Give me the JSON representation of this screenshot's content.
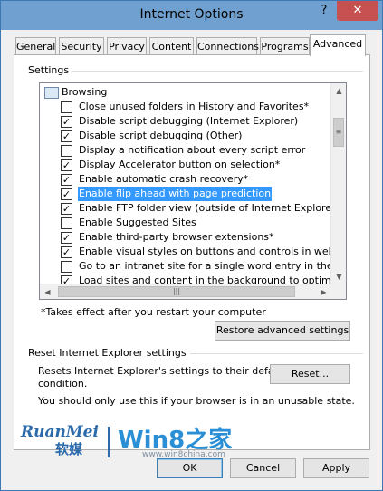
{
  "window": {
    "title": "Internet Options",
    "help_glyph": "?",
    "close_glyph": "✕"
  },
  "tabs": [
    {
      "label": "General",
      "active": false
    },
    {
      "label": "Security",
      "active": false
    },
    {
      "label": "Privacy",
      "active": false
    },
    {
      "label": "Content",
      "active": false
    },
    {
      "label": "Connections",
      "active": false
    },
    {
      "label": "Programs",
      "active": false
    },
    {
      "label": "Advanced",
      "active": true
    }
  ],
  "settings": {
    "group_label": "Settings",
    "category": "Browsing",
    "items": [
      {
        "label": "Close unused folders in History and Favorites*",
        "checked": false,
        "selected": false
      },
      {
        "label": "Disable script debugging (Internet Explorer)",
        "checked": true,
        "selected": false
      },
      {
        "label": "Disable script debugging (Other)",
        "checked": true,
        "selected": false
      },
      {
        "label": "Display a notification about every script error",
        "checked": false,
        "selected": false
      },
      {
        "label": "Display Accelerator button on selection*",
        "checked": true,
        "selected": false
      },
      {
        "label": "Enable automatic crash recovery*",
        "checked": true,
        "selected": false
      },
      {
        "label": "Enable flip ahead with page prediction",
        "checked": true,
        "selected": true
      },
      {
        "label": "Enable FTP folder view (outside of Internet Explorer)",
        "checked": true,
        "selected": false
      },
      {
        "label": "Enable Suggested Sites",
        "checked": false,
        "selected": false
      },
      {
        "label": "Enable third-party browser extensions*",
        "checked": true,
        "selected": false
      },
      {
        "label": "Enable visual styles on buttons and controls in webpages",
        "checked": true,
        "selected": false
      },
      {
        "label": "Go to an intranet site for a single word entry in the Address",
        "checked": false,
        "selected": false
      },
      {
        "label": "Load sites and content in the background to optimize perfo",
        "checked": true,
        "selected": false
      }
    ],
    "check_glyph": "✓",
    "note": "*Takes effect after you restart your computer",
    "restore_button": "Restore advanced settings"
  },
  "reset": {
    "group_label": "Reset Internet Explorer settings",
    "description_line1": "Resets Internet Explorer's settings to their default",
    "description_line2": "condition.",
    "button": "Reset...",
    "warning": "You should only use this if your browser is in an unusable state."
  },
  "footer": {
    "ok": "OK",
    "cancel": "Cancel",
    "apply": "Apply"
  },
  "watermark": {
    "brand": "RuanMei",
    "brand_cn": "软媒",
    "site": "Win8之家",
    "url": "www.win8china.com"
  },
  "colors": {
    "selection": "#3399ff",
    "titlebar": "#6fa0cf",
    "close": "#c75050"
  }
}
